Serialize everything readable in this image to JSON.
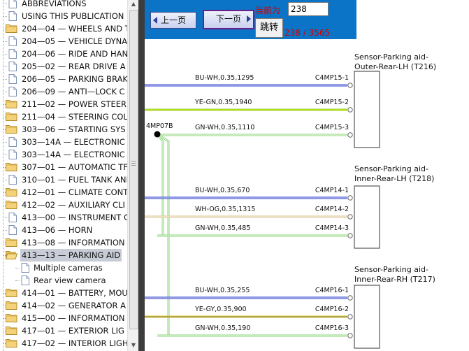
{
  "tree": {
    "items": [
      {
        "label": "ABBREVIATIONS",
        "icon": "doc-icon"
      },
      {
        "label": "USING THIS PUBLICATION",
        "icon": "doc-icon"
      },
      {
        "label": "204—04 — WHEELS AND T",
        "icon": "folder-icon"
      },
      {
        "label": "204—05 — VEHICLE DYNA",
        "icon": "doc-icon"
      },
      {
        "label": "204—06 — RIDE AND HAN",
        "icon": "doc-icon"
      },
      {
        "label": "205—02 — REAR DRIVE A",
        "icon": "doc-icon"
      },
      {
        "label": "206—05 — PARKING BRAK",
        "icon": "doc-icon"
      },
      {
        "label": "206—09 — ANTI—LOCK C",
        "icon": "doc-icon"
      },
      {
        "label": "211—02 — POWER STEER",
        "icon": "folder-icon"
      },
      {
        "label": "211—04 — STEERING COL",
        "icon": "folder-icon"
      },
      {
        "label": "303—06 — STARTING SYS",
        "icon": "folder-icon"
      },
      {
        "label": "303—14A — ELECTRONIC",
        "icon": "doc-icon"
      },
      {
        "label": "303—14A — ELECTRONIC",
        "icon": "doc-icon"
      },
      {
        "label": "307—01 — AUTOMATIC TF",
        "icon": "folder-icon"
      },
      {
        "label": "310—01 — FUEL TANK ANI",
        "icon": "doc-icon"
      },
      {
        "label": "412—01 — CLIMATE CONT",
        "icon": "folder-icon"
      },
      {
        "label": "412—02 — AUXILIARY CLI",
        "icon": "folder-icon"
      },
      {
        "label": "413—00 — INSTRUMENT C",
        "icon": "doc-icon"
      },
      {
        "label": "413—06 — HORN",
        "icon": "doc-icon"
      },
      {
        "label": "413—08 — INFORMATION",
        "icon": "folder-icon"
      },
      {
        "label": "413—13 — PARKING AID",
        "icon": "folder-open-icon",
        "selected": true
      },
      {
        "label": "Multiple cameras",
        "icon": "doc-icon",
        "child": true
      },
      {
        "label": "Rear view camera",
        "icon": "doc-icon",
        "child": true
      },
      {
        "label": "414—01 — BATTERY, MOU",
        "icon": "folder-icon"
      },
      {
        "label": "414—02 — GENERATOR A",
        "icon": "folder-icon"
      },
      {
        "label": "415—00 — INFORMATION",
        "icon": "folder-icon"
      },
      {
        "label": "417—01 — EXTERIOR LIG",
        "icon": "folder-icon"
      },
      {
        "label": "417—02 — INTERIOR LIGH",
        "icon": "folder-icon"
      }
    ]
  },
  "toolbar": {
    "prev_label": "上一页",
    "next_label": "下一页",
    "current_label": "当前为",
    "page_value": "238",
    "jump_label": "跳转",
    "page_count": "238 / 3565"
  },
  "diagram": {
    "splice_label": "4MP07B",
    "components": [
      {
        "name_line1": "Sensor-Parking aid-",
        "name_line2": "Outer-Rear-LH (T216)"
      },
      {
        "name_line1": "Sensor-Parking aid-",
        "name_line2": "Inner-Rear-LH (T218)"
      },
      {
        "name_line1": "Sensor-Parking aid-",
        "name_line2": "Inner-Rear-RH (T217)"
      }
    ],
    "wires": [
      {
        "label": "BU-WH,0.35,1295",
        "pin": "C4MP15-1",
        "color": "#2233cc",
        "color2": "#ffffff"
      },
      {
        "label": "YE-GN,0.35,1940",
        "pin": "C4MP15-2",
        "color": "#8ed63a",
        "color2": "#e0e000"
      },
      {
        "label": "GN-WH,0.35,1110",
        "pin": "C4MP15-3",
        "color": "#8bd67a",
        "color2": "#ffffff"
      },
      {
        "label": "BU-WH,0.35,670",
        "pin": "C4MP14-1",
        "color": "#2233cc",
        "color2": "#ffffff"
      },
      {
        "label": "WH-OG,0.35,1315",
        "pin": "C4MP14-2",
        "color": "#d9c28a",
        "color2": "#ffffff"
      },
      {
        "label": "GN-WH,0.35,485",
        "pin": "C4MP14-3",
        "color": "#8bd67a",
        "color2": "#ffffff"
      },
      {
        "label": "BU-WH,0.35,255",
        "pin": "C4MP16-1",
        "color": "#2233cc",
        "color2": "#ffffff"
      },
      {
        "label": "YE-GY,0.35,900",
        "pin": "C4MP16-2",
        "color": "#d8c01a",
        "color2": "#888888"
      },
      {
        "label": "GN-WH,0.35,190",
        "pin": "C4MP16-3",
        "color": "#8bd67a",
        "color2": "#ffffff"
      }
    ]
  }
}
